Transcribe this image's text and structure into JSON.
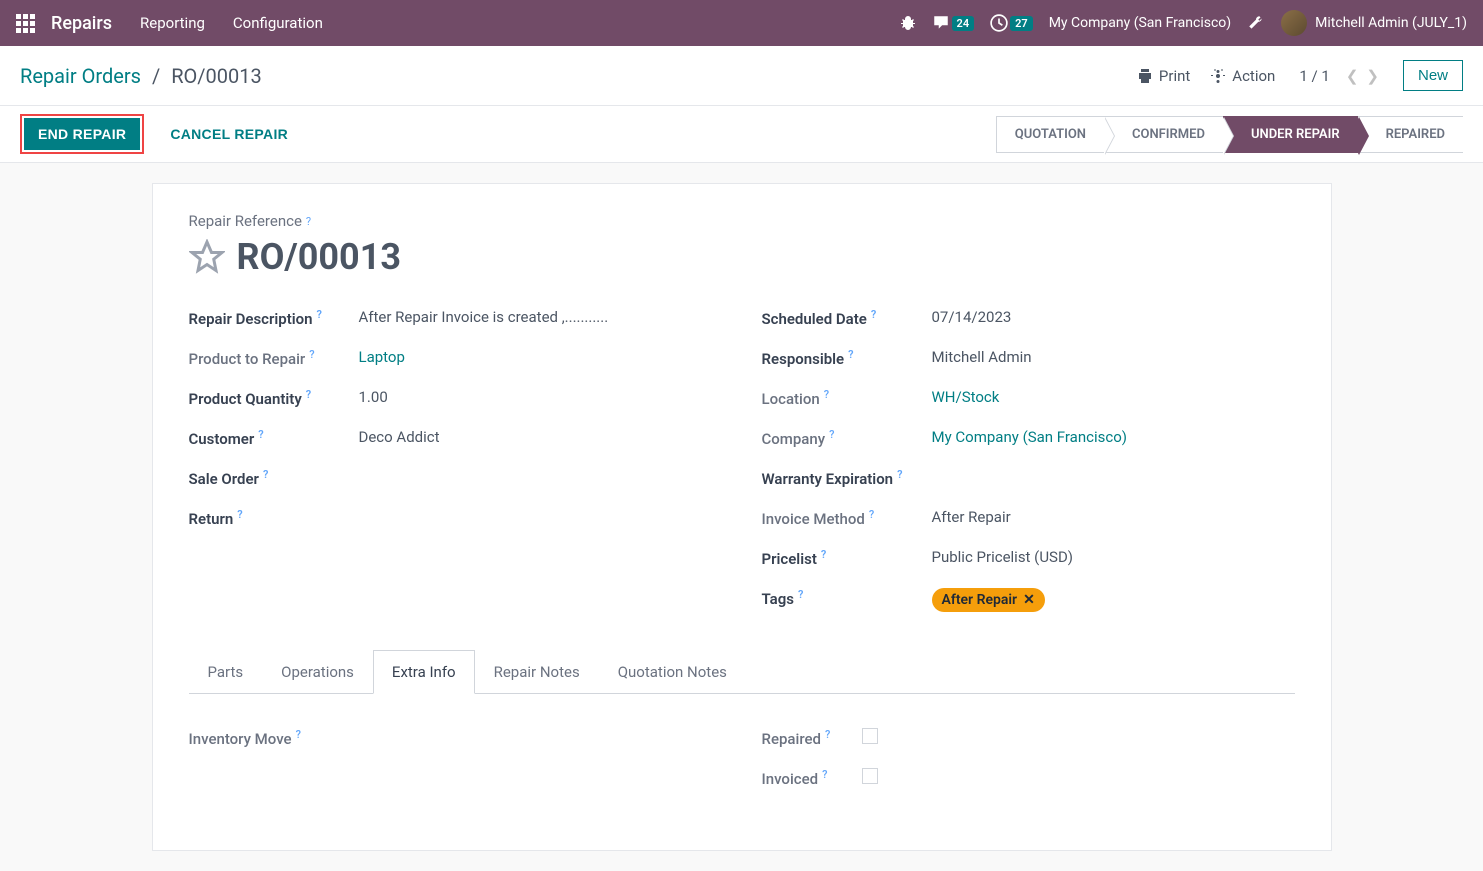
{
  "nav": {
    "brand": "Repairs",
    "menu": [
      "Reporting",
      "Configuration"
    ],
    "messages_count": "24",
    "activities_count": "27",
    "company": "My Company (San Francisco)",
    "user": "Mitchell Admin (JULY_1)"
  },
  "breadcrumb": {
    "parent": "Repair Orders",
    "current": "RO/00013"
  },
  "controls": {
    "print": "Print",
    "action": "Action",
    "pager": "1 / 1",
    "new": "New"
  },
  "buttons": {
    "end_repair": "END REPAIR",
    "cancel_repair": "CANCEL REPAIR"
  },
  "statuses": {
    "quotation": "QUOTATION",
    "confirmed": "CONFIRMED",
    "under_repair": "UNDER REPAIR",
    "repaired": "REPAIRED"
  },
  "form": {
    "ref_label": "Repair Reference",
    "ref": "RO/00013",
    "left": {
      "desc_label": "Repair Description",
      "desc": "After Repair Invoice is created ,...........",
      "product_label": "Product to Repair",
      "product": "Laptop",
      "qty_label": "Product Quantity",
      "qty": "1.00",
      "customer_label": "Customer",
      "customer": "Deco Addict",
      "sale_order_label": "Sale Order",
      "return_label": "Return"
    },
    "right": {
      "date_label": "Scheduled Date",
      "date": "07/14/2023",
      "responsible_label": "Responsible",
      "responsible": "Mitchell Admin",
      "location_label": "Location",
      "location": "WH/Stock",
      "company_label": "Company",
      "company": "My Company (San Francisco)",
      "warranty_label": "Warranty Expiration",
      "invoice_method_label": "Invoice Method",
      "invoice_method": "After Repair",
      "pricelist_label": "Pricelist",
      "pricelist": "Public Pricelist (USD)",
      "tags_label": "Tags",
      "tag": "After Repair"
    }
  },
  "tabs": {
    "parts": "Parts",
    "operations": "Operations",
    "extra_info": "Extra Info",
    "repair_notes": "Repair Notes",
    "quotation_notes": "Quotation Notes"
  },
  "extra": {
    "inventory_move_label": "Inventory Move",
    "repaired_label": "Repaired",
    "invoiced_label": "Invoiced"
  }
}
